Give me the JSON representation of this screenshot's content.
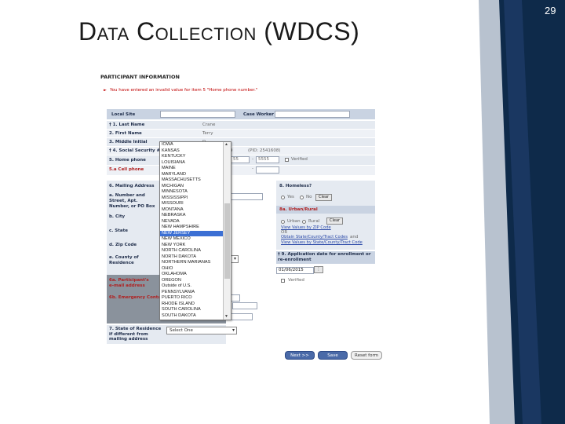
{
  "slide": {
    "title": "Data Collection (WDCS)",
    "page_number": "29"
  },
  "form": {
    "section_header": "PARTICIPANT INFORMATION",
    "error_message": "You have entered an invalid value for item 5 \"Home phone number.\"",
    "local_site_label": "Local Site",
    "case_worker_label": "Case Worker",
    "last_name_label": "† 1. Last Name",
    "last_name_value": "Crane",
    "first_name_label": "2. First Name",
    "first_name_value": "Terry",
    "middle_initial_label": "3. Middle Initial",
    "middle_initial_value": "D.",
    "ssn_label": "† 4. Social Security #",
    "ssn_partial": "9",
    "pid_text": "(PID: 2541608)",
    "home_phone_label": "5. Home phone",
    "home_phone_part2": "55",
    "home_phone_part3": "5555",
    "verified_label": "Verified",
    "cell_phone_label": "5.a Cell phone",
    "mailing_address_label": "6. Mailing Address",
    "street_label": "a. Number and Street, Apt. Number, or PO Box",
    "city_label": "b. City",
    "state_label": "c. State",
    "zip_label": "d. Zip Code",
    "county_label": "e. County of Residence",
    "email_label": "6a. Participant's e-mail address",
    "emergency_label": "6b. Emergency Contact",
    "state_residence_label": "7. State of Residence if different from mailing address",
    "state_residence_value": "Select One",
    "homeless_label": "8. Homeless?",
    "yes_label": "Yes",
    "no_label": "No",
    "clear_label": "Clear",
    "urban_rural_label": "8a. Urban/Rural",
    "urban_label": "Urban",
    "rural_label": "Rural",
    "link_zip": "View Values by ZIP Code",
    "or_text": "OR",
    "link_tract_a": "Obtain State/County/Tract Codes",
    "and_text": "and",
    "link_tract_b": "View Values by State/County/Tract Code",
    "app_date_label": "† 9. Application date for enrollment or re-enrollment",
    "app_date_value": "01/06/2015",
    "next_button": "Next  >>",
    "save_button": "Save",
    "reset_button": "Reset form"
  },
  "dropdown": {
    "options": [
      "IOWA",
      "KANSAS",
      "KENTUCKY",
      "LOUISIANA",
      "MAINE",
      "MARYLAND",
      "MASSACHUSETTS",
      "MICHIGAN",
      "MINNESOTA",
      "MISSISSIPPI",
      "MISSOURI",
      "MONTANA",
      "NEBRASKA",
      "NEVADA",
      "NEW HAMPSHIRE",
      "NEW JERSEY",
      "NEW MEXICO",
      "NEW YORK",
      "NORTH CAROLINA",
      "NORTH DAKOTA",
      "NORTHERN MARIANAS",
      "OHIO",
      "OKLAHOMA",
      "OREGON",
      "Outside of U.S.",
      "PENNSYLVANIA",
      "PUERTO RICO",
      "RHODE ISLAND",
      "SOUTH CAROLINA",
      "SOUTH DAKOTA"
    ],
    "selected": "NEW JERSEY"
  },
  "colors": {
    "navy": "#0e2a4a",
    "steel": "#1f3d6b",
    "form_header": "#c9d3e2",
    "selected": "#3b6fd4"
  }
}
